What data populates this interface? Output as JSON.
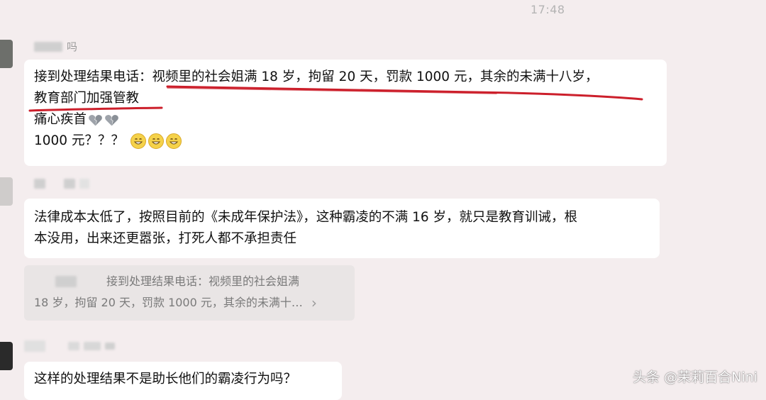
{
  "status_bar": {
    "time": "17:48"
  },
  "messages": [
    {
      "sender_suffix": "吗",
      "lines": [
        "接到处理结果电话：视频里的社会姐满 18 岁，拘留 20 天，罚款 1000 元，其余的未满十八岁，",
        "教育部门加强管教",
        "痛心疾首",
        "1000 元？？？"
      ],
      "emojis": {
        "line3": "broken-heart",
        "line4": "grin"
      }
    },
    {
      "lines": [
        "法律成本太低了，按照目前的《未成年保护法》，这种霸凌的不满 16 岁，就只是教育训诫，根",
        "本没用，出来还更嚣张，打死人都不承担责任"
      ]
    },
    {
      "quote_lines": [
        "接到处理结果电话：视频里的社会姐满",
        "18 岁，拘留 20 天，罚款 1000 元，其余的未满十…"
      ],
      "quote_arrow": "›"
    },
    {
      "lines": [
        "这样的处理结果不是助长他们的霸凌行为吗？"
      ]
    }
  ],
  "watermark": "头条 @茉莉百合Nini",
  "colors": {
    "background": "#f4edee",
    "bubble": "#ffffff",
    "quote": "#e9e5e5",
    "annotation_red": "#cc1f2b"
  }
}
